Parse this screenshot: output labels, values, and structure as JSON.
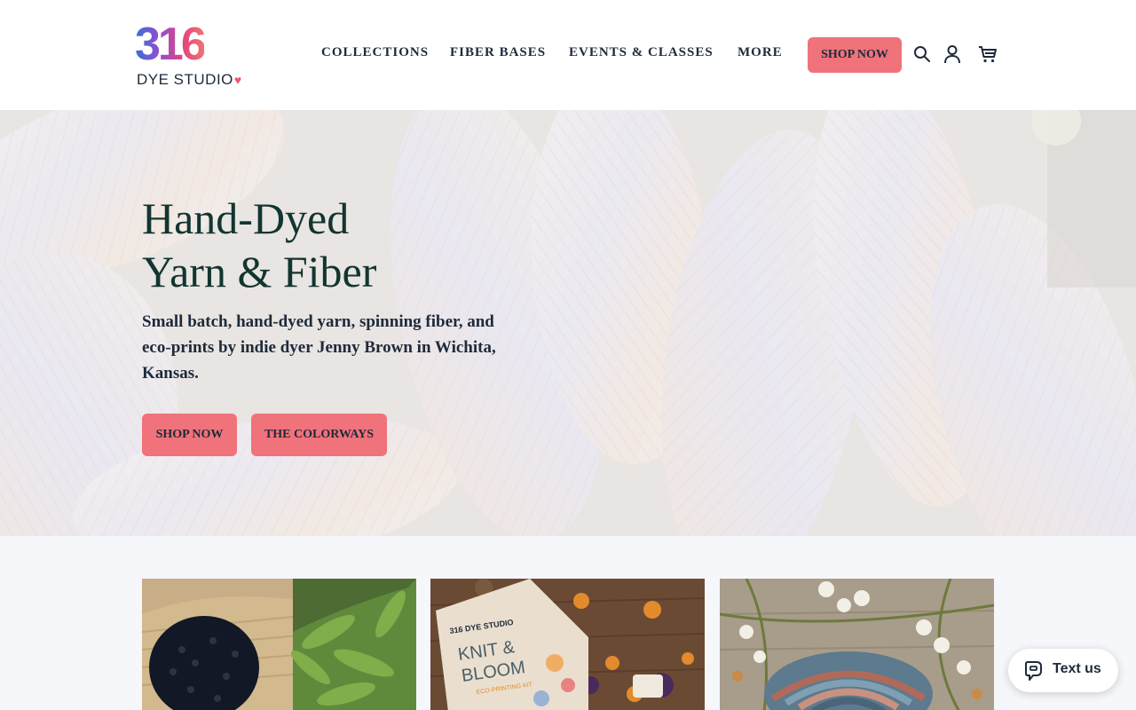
{
  "brand": {
    "logo_number": "316",
    "logo_subtitle": "DYE STUDIO",
    "logo_heart": "♥"
  },
  "nav": {
    "items": [
      {
        "label": "COLLECTIONS"
      },
      {
        "label": "FIBER BASES"
      },
      {
        "label": "EVENTS & CLASSES"
      },
      {
        "label": "MORE"
      }
    ],
    "shop_now": "SHOP NOW"
  },
  "icons": {
    "search": "search-icon",
    "account": "account-icon",
    "cart": "cart-icon"
  },
  "hero": {
    "title_line1": "Hand-Dyed",
    "title_line2": "Yarn & Fiber",
    "description": "Small batch, hand-dyed yarn, spinning fiber, and eco-prints by indie dyer Jenny Brown in Wichita, Kansas.",
    "btn_shop": "SHOP NOW",
    "btn_colorways": "THE COLORWAYS"
  },
  "cards": [
    {
      "name": "card-berries-herbs"
    },
    {
      "name": "card-knit-bloom-kit"
    },
    {
      "name": "card-spinning-fiber"
    }
  ],
  "kit_box": {
    "brand": "316 DYE STUDIO",
    "title_line1": "KNIT &",
    "title_line2": "BLOOM",
    "subtitle": "ECO-PRINTING KIT"
  },
  "chat": {
    "label": "Text us"
  },
  "colors": {
    "accent": "#f0727a",
    "title": "#123530",
    "text": "#1d2a3a"
  }
}
